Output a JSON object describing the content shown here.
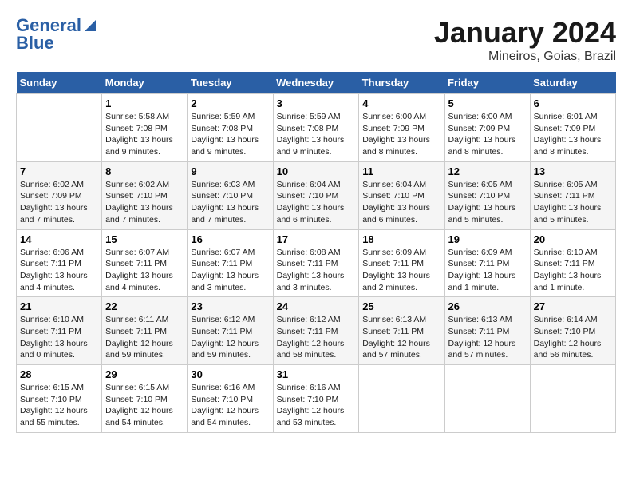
{
  "header": {
    "logo_line1": "General",
    "logo_line2": "Blue",
    "title": "January 2024",
    "subtitle": "Mineiros, Goias, Brazil"
  },
  "weekdays": [
    "Sunday",
    "Monday",
    "Tuesday",
    "Wednesday",
    "Thursday",
    "Friday",
    "Saturday"
  ],
  "weeks": [
    [
      {
        "day": "",
        "info": ""
      },
      {
        "day": "1",
        "info": "Sunrise: 5:58 AM\nSunset: 7:08 PM\nDaylight: 13 hours and 9 minutes."
      },
      {
        "day": "2",
        "info": "Sunrise: 5:59 AM\nSunset: 7:08 PM\nDaylight: 13 hours and 9 minutes."
      },
      {
        "day": "3",
        "info": "Sunrise: 5:59 AM\nSunset: 7:08 PM\nDaylight: 13 hours and 9 minutes."
      },
      {
        "day": "4",
        "info": "Sunrise: 6:00 AM\nSunset: 7:09 PM\nDaylight: 13 hours and 8 minutes."
      },
      {
        "day": "5",
        "info": "Sunrise: 6:00 AM\nSunset: 7:09 PM\nDaylight: 13 hours and 8 minutes."
      },
      {
        "day": "6",
        "info": "Sunrise: 6:01 AM\nSunset: 7:09 PM\nDaylight: 13 hours and 8 minutes."
      }
    ],
    [
      {
        "day": "7",
        "info": "Sunrise: 6:02 AM\nSunset: 7:09 PM\nDaylight: 13 hours and 7 minutes."
      },
      {
        "day": "8",
        "info": "Sunrise: 6:02 AM\nSunset: 7:10 PM\nDaylight: 13 hours and 7 minutes."
      },
      {
        "day": "9",
        "info": "Sunrise: 6:03 AM\nSunset: 7:10 PM\nDaylight: 13 hours and 7 minutes."
      },
      {
        "day": "10",
        "info": "Sunrise: 6:04 AM\nSunset: 7:10 PM\nDaylight: 13 hours and 6 minutes."
      },
      {
        "day": "11",
        "info": "Sunrise: 6:04 AM\nSunset: 7:10 PM\nDaylight: 13 hours and 6 minutes."
      },
      {
        "day": "12",
        "info": "Sunrise: 6:05 AM\nSunset: 7:10 PM\nDaylight: 13 hours and 5 minutes."
      },
      {
        "day": "13",
        "info": "Sunrise: 6:05 AM\nSunset: 7:11 PM\nDaylight: 13 hours and 5 minutes."
      }
    ],
    [
      {
        "day": "14",
        "info": "Sunrise: 6:06 AM\nSunset: 7:11 PM\nDaylight: 13 hours and 4 minutes."
      },
      {
        "day": "15",
        "info": "Sunrise: 6:07 AM\nSunset: 7:11 PM\nDaylight: 13 hours and 4 minutes."
      },
      {
        "day": "16",
        "info": "Sunrise: 6:07 AM\nSunset: 7:11 PM\nDaylight: 13 hours and 3 minutes."
      },
      {
        "day": "17",
        "info": "Sunrise: 6:08 AM\nSunset: 7:11 PM\nDaylight: 13 hours and 3 minutes."
      },
      {
        "day": "18",
        "info": "Sunrise: 6:09 AM\nSunset: 7:11 PM\nDaylight: 13 hours and 2 minutes."
      },
      {
        "day": "19",
        "info": "Sunrise: 6:09 AM\nSunset: 7:11 PM\nDaylight: 13 hours and 1 minute."
      },
      {
        "day": "20",
        "info": "Sunrise: 6:10 AM\nSunset: 7:11 PM\nDaylight: 13 hours and 1 minute."
      }
    ],
    [
      {
        "day": "21",
        "info": "Sunrise: 6:10 AM\nSunset: 7:11 PM\nDaylight: 13 hours and 0 minutes."
      },
      {
        "day": "22",
        "info": "Sunrise: 6:11 AM\nSunset: 7:11 PM\nDaylight: 12 hours and 59 minutes."
      },
      {
        "day": "23",
        "info": "Sunrise: 6:12 AM\nSunset: 7:11 PM\nDaylight: 12 hours and 59 minutes."
      },
      {
        "day": "24",
        "info": "Sunrise: 6:12 AM\nSunset: 7:11 PM\nDaylight: 12 hours and 58 minutes."
      },
      {
        "day": "25",
        "info": "Sunrise: 6:13 AM\nSunset: 7:11 PM\nDaylight: 12 hours and 57 minutes."
      },
      {
        "day": "26",
        "info": "Sunrise: 6:13 AM\nSunset: 7:11 PM\nDaylight: 12 hours and 57 minutes."
      },
      {
        "day": "27",
        "info": "Sunrise: 6:14 AM\nSunset: 7:10 PM\nDaylight: 12 hours and 56 minutes."
      }
    ],
    [
      {
        "day": "28",
        "info": "Sunrise: 6:15 AM\nSunset: 7:10 PM\nDaylight: 12 hours and 55 minutes."
      },
      {
        "day": "29",
        "info": "Sunrise: 6:15 AM\nSunset: 7:10 PM\nDaylight: 12 hours and 54 minutes."
      },
      {
        "day": "30",
        "info": "Sunrise: 6:16 AM\nSunset: 7:10 PM\nDaylight: 12 hours and 54 minutes."
      },
      {
        "day": "31",
        "info": "Sunrise: 6:16 AM\nSunset: 7:10 PM\nDaylight: 12 hours and 53 minutes."
      },
      {
        "day": "",
        "info": ""
      },
      {
        "day": "",
        "info": ""
      },
      {
        "day": "",
        "info": ""
      }
    ]
  ]
}
